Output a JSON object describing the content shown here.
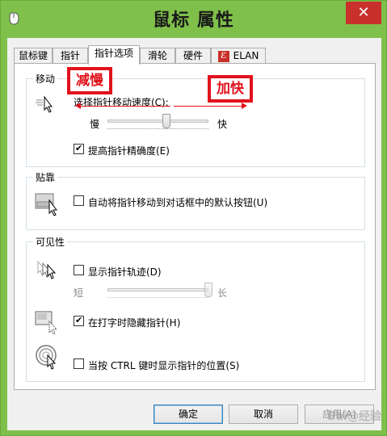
{
  "window": {
    "title": "鼠标 属性",
    "close_glyph": "✕"
  },
  "tabs": [
    {
      "label": "鼠标键"
    },
    {
      "label": "指针"
    },
    {
      "label": "指针选项"
    },
    {
      "label": "滑轮"
    },
    {
      "label": "硬件"
    },
    {
      "label": "ELAN"
    }
  ],
  "motion": {
    "title": "移动",
    "speed_label": "选择指针移动速度(C):",
    "slow": "慢",
    "fast": "快",
    "speed_level": 0.58,
    "enhance_precision": {
      "label": "提高指针精确度(E)",
      "checked": true
    }
  },
  "snapto": {
    "title": "贴靠",
    "option": {
      "label": "自动将指针移动到对话框中的默认按钮(U)",
      "checked": false
    }
  },
  "visibility": {
    "title": "可见性",
    "trails": {
      "label": "显示指针轨迹(D)",
      "checked": false
    },
    "short": "短",
    "long": "长",
    "trail_level": 1.0,
    "hide_typing": {
      "label": "在打字时隐藏指针(H)",
      "checked": true
    },
    "show_ctrl": {
      "label": "当按 CTRL 键时显示指针的位置(S)",
      "checked": false
    }
  },
  "annotations": {
    "slower": "减慢",
    "faster": "加快",
    "color": "#e1121c"
  },
  "buttons": {
    "ok": "确定",
    "cancel": "取消",
    "apply": "应用(A)"
  },
  "watermark": "Bai@经验"
}
